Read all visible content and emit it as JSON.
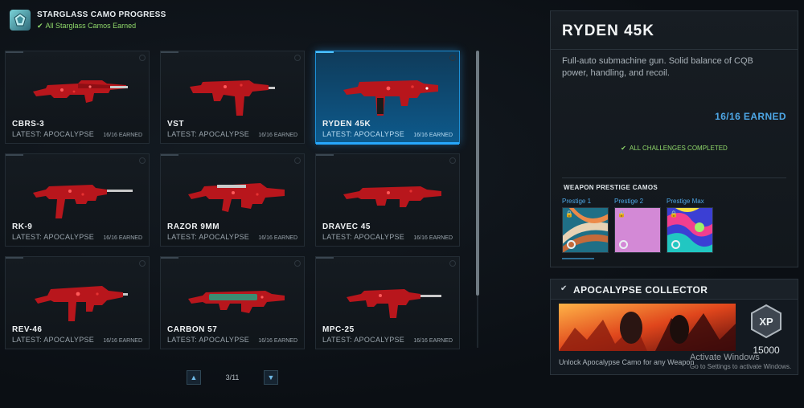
{
  "header": {
    "title": "STARGLASS CAMO PROGRESS",
    "subtitle": "All Starglass Camos Earned"
  },
  "weapons": [
    {
      "name": "CBRS-3",
      "latest": "LATEST: APOCALYPSE",
      "earned": "16/16 EARNED"
    },
    {
      "name": "VST",
      "latest": "LATEST: APOCALYPSE",
      "earned": "16/16 EARNED"
    },
    {
      "name": "RYDEN 45K",
      "latest": "LATEST: APOCALYPSE",
      "earned": "16/16 EARNED"
    },
    {
      "name": "RK-9",
      "latest": "LATEST: APOCALYPSE",
      "earned": "16/16 EARNED"
    },
    {
      "name": "RAZOR 9MM",
      "latest": "LATEST: APOCALYPSE",
      "earned": "16/16 EARNED"
    },
    {
      "name": "DRAVEC 45",
      "latest": "LATEST: APOCALYPSE",
      "earned": "16/16 EARNED"
    },
    {
      "name": "REV-46",
      "latest": "LATEST: APOCALYPSE",
      "earned": "16/16 EARNED"
    },
    {
      "name": "CARBON 57",
      "latest": "LATEST: APOCALYPSE",
      "earned": "16/16 EARNED"
    },
    {
      "name": "MPC-25",
      "latest": "LATEST: APOCALYPSE",
      "earned": "16/16 EARNED"
    }
  ],
  "selected_weapon": "RYDEN 45K",
  "pager": {
    "page": "3/11"
  },
  "detail": {
    "title": "RYDEN 45K",
    "description": "Full-auto submachine gun. Solid balance of CQB power, handling, and recoil.",
    "earned": "16/16 EARNED",
    "status": "ALL CHALLENGES COMPLETED",
    "prestige_title": "WEAPON PRESTIGE CAMOS",
    "prestige": [
      {
        "label": "Prestige 1"
      },
      {
        "label": "Prestige 2"
      },
      {
        "label": "Prestige Max"
      }
    ]
  },
  "collector": {
    "title": "APOCALYPSE COLLECTOR",
    "description": "Unlock Apocalypse Camo for any Weapon",
    "xp_badge": "XP",
    "xp_value": "15000"
  },
  "watermark": {
    "title": "Activate Windows",
    "subtitle": "Go to Settings to activate Windows."
  },
  "colors": {
    "accent": "#27a8ff",
    "success": "#8fd86a",
    "camo_red": "#c0161c"
  }
}
